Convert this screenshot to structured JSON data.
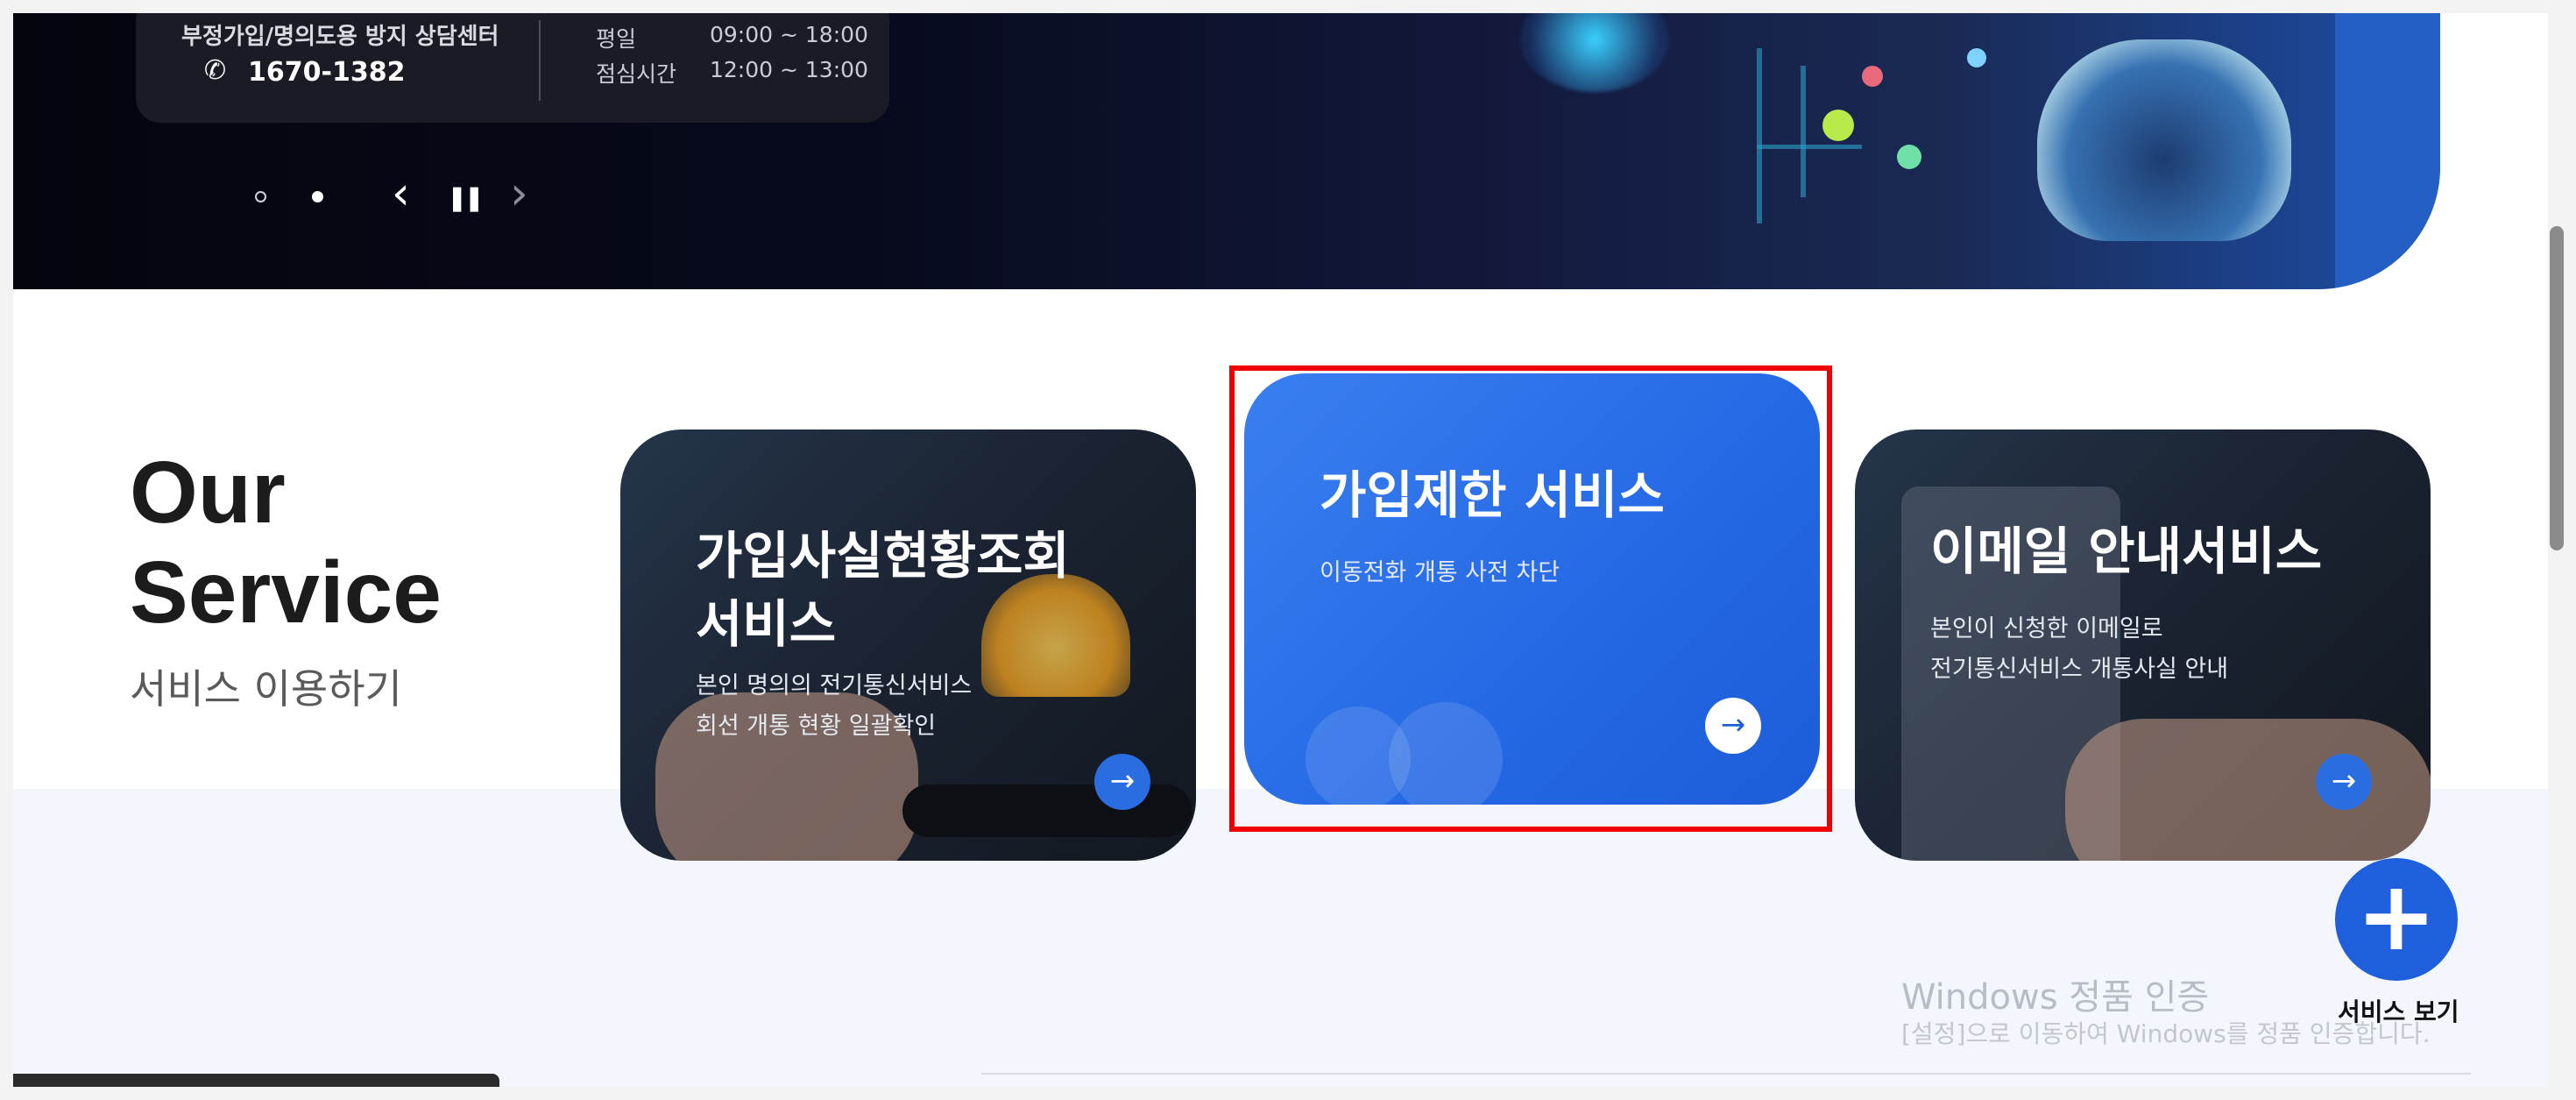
{
  "hero": {
    "contact_title": "부정가입/명의도용 방지 상담센터",
    "phone_number": "1670-1382",
    "weekday_label": "평일",
    "weekday_hours": "09:00 ~ 18:00",
    "lunch_label": "점심시간",
    "lunch_hours": "12:00 ~ 13:00",
    "controls": {
      "prev": "‹",
      "pause": "❚❚",
      "next": "›"
    }
  },
  "services": {
    "heading_line1": "Our",
    "heading_line2": "Service",
    "subheading": "서비스 이용하기",
    "cards": [
      {
        "title_line1": "가입사실현황조회",
        "title_line2": "서비스",
        "desc_line1": "본인 명의의 전기통신서비스",
        "desc_line2": "회선 개통 현황 일괄확인",
        "arrow": "→"
      },
      {
        "title_line1": "가입제한 서비스",
        "desc_line1": "이동전화 개통 사전 차단",
        "arrow": "→"
      },
      {
        "title_line1": "이메일 안내서비스",
        "desc_line1": "본인이 신청한 이메일로",
        "desc_line2": "전기통신서비스 개통사실 안내",
        "arrow": "→"
      }
    ]
  },
  "fab": {
    "icon": "+",
    "label": "서비스 보기"
  },
  "watermark": {
    "line1": "Windows 정품 인증",
    "line2": "[설정]으로 이동하여 Windows를 정품 인증합니다."
  },
  "colors": {
    "accent": "#1f5fdc",
    "highlight": "#ee0000",
    "hero_bg": "#070a1c"
  },
  "icons": {
    "phone": "phone-icon",
    "arrow": "arrow-right-icon",
    "plus": "plus-icon"
  }
}
